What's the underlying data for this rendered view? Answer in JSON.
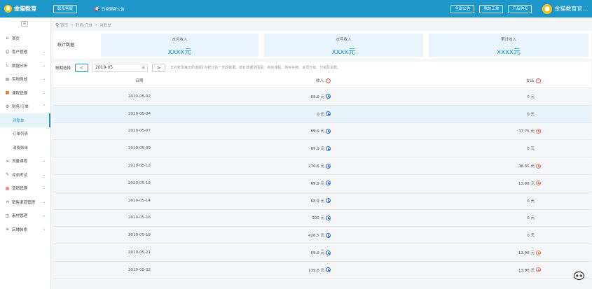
{
  "header": {
    "logo": "金猫教育",
    "contact_button": "联系客服",
    "notice": "日常更新公告",
    "buttons": [
      "全部公告",
      "我的工单",
      "产品购买"
    ],
    "user_name": "金猫教育官..."
  },
  "sidebar": {
    "items": [
      {
        "label": "首页",
        "icon": "home-icon",
        "arrow": false
      },
      {
        "label": "客户管理",
        "icon": "user-icon",
        "arrow": true
      },
      {
        "label": "数据分析",
        "icon": "chart-icon",
        "arrow": true
      },
      {
        "label": "实物商城",
        "icon": "shop-icon",
        "arrow": true
      },
      {
        "label": "课程管理",
        "icon": "course-icon",
        "arrow": true
      },
      {
        "label": "财务/订单",
        "icon": "finance-icon",
        "arrow": true,
        "expanded": true
      },
      {
        "label": "对账单",
        "sub": true,
        "active": true
      },
      {
        "label": "订单列表",
        "sub": true
      },
      {
        "label": "消费账单",
        "sub": true
      },
      {
        "label": "流量课程",
        "icon": "flow-icon",
        "arrow": true
      },
      {
        "label": "评测考试",
        "icon": "exam-icon",
        "arrow": true
      },
      {
        "label": "营销管理",
        "icon": "grid-icon",
        "arrow": true
      },
      {
        "label": "销售渠道管理",
        "icon": "share-icon",
        "arrow": true
      },
      {
        "label": "素材管理",
        "icon": "folder-icon",
        "arrow": true
      },
      {
        "label": "店铺装修",
        "icon": "list-icon",
        "arrow": true
      }
    ]
  },
  "breadcrumb": [
    "首页",
    "财务/订单",
    "对账单"
  ],
  "stats": {
    "title": "统计数据",
    "cards": [
      {
        "label": "本月收入",
        "value": "xxxx元"
      },
      {
        "label": "本年收入",
        "value": "xxxx元"
      },
      {
        "label": "累计收入",
        "value": "xxxx元"
      }
    ]
  },
  "filter": {
    "label": "账期选择",
    "prev": "<",
    "date": "2019-05",
    "next": ">",
    "hint": "日对账单每天的凌晨1点统计前一天的数据。统计数据范围是：购买课程、购买实物、会员升级、分销及退款。"
  },
  "table": {
    "headers": [
      "日期",
      "收入",
      "支出"
    ],
    "rows": [
      {
        "date": "2019-05-02",
        "income": "69.9 元",
        "expense": "0 元",
        "expense_icon": false
      },
      {
        "date": "2019-05-04",
        "income": "0 元",
        "expense": "0 元",
        "expense_icon": false,
        "highlight": true
      },
      {
        "date": "2019-05-07",
        "income": "69.9 元",
        "expense": "37.75 元",
        "expense_icon": true
      },
      {
        "date": "2019-05-09",
        "income": "69.9 元",
        "expense": "0 元",
        "expense_icon": false
      },
      {
        "date": "2019-05-12",
        "income": "276.6 元",
        "expense": "36.35 元",
        "expense_icon": true
      },
      {
        "date": "2019-05-13",
        "income": "69.9 元",
        "expense": "13.98 元",
        "expense_icon": true
      },
      {
        "date": "2019-05-14",
        "income": "68.9 元",
        "expense": "0 元",
        "expense_icon": false
      },
      {
        "date": "2019-05-16",
        "income": "900 元",
        "expense": "0 元",
        "expense_icon": false
      },
      {
        "date": "2019-05-18",
        "income": "428.5 元",
        "expense": "0 元",
        "expense_icon": false
      },
      {
        "date": "2019-05-21",
        "income": "69.9 元",
        "expense": "13.98 元",
        "expense_icon": true
      },
      {
        "date": "2019-05-22",
        "income": "139.8 元",
        "expense": "13.98 元",
        "expense_icon": true
      }
    ]
  }
}
